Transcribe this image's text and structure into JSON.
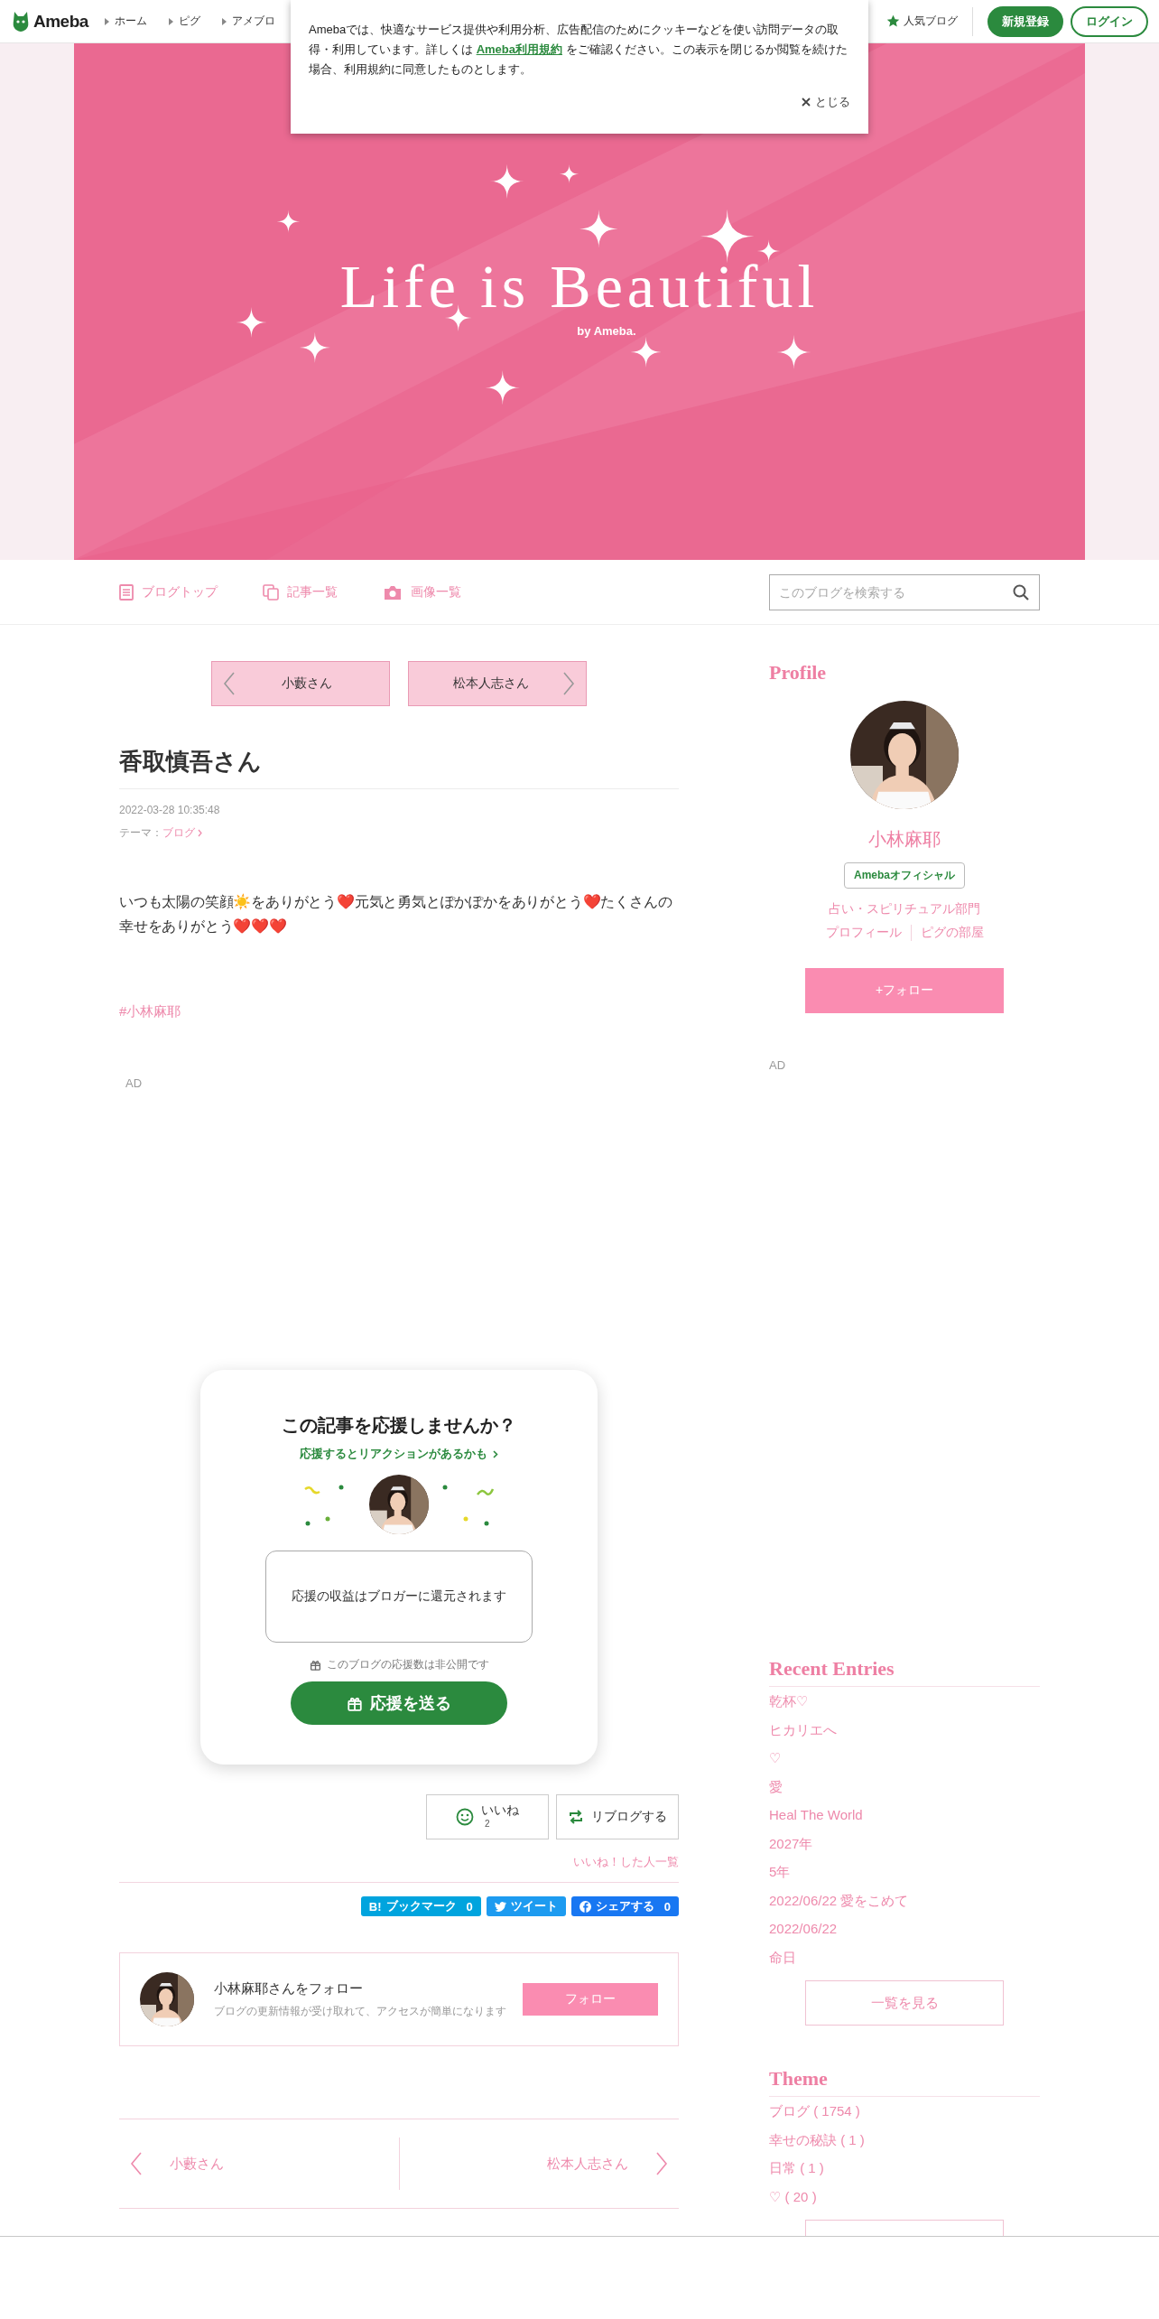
{
  "top_bar": {
    "logo": "Ameba",
    "nav": [
      "ホーム",
      "ピグ",
      "アメブロ"
    ],
    "popular": "人気ブログ",
    "signup": "新規登録",
    "login": "ログイン"
  },
  "cookie_notice": {
    "text": "Amebaでは、快適なサービス提供や利用分析、広告配信のためにクッキーなどを使い訪問データの取得・利用しています。詳しくは",
    "link": "Ameba利用規約",
    "text_after": "をご確認ください。この表示を閉じるか閲覧を続けた場合、利用規約に同意したものとします。",
    "close": "とじる"
  },
  "header": {
    "title": "Life is Beautiful",
    "byline": "by Ameba."
  },
  "blog_nav": {
    "items": [
      {
        "label": "ブログトップ",
        "kind": "list"
      },
      {
        "label": "記事一覧",
        "kind": "pages"
      },
      {
        "label": "画像一覧",
        "kind": "camera"
      }
    ],
    "search": {
      "placeholder": "このブログを検索する"
    }
  },
  "article": {
    "prev": "小藪さん",
    "next": "松本人志さん",
    "title": "香取慎吾さん",
    "date": "2022-03-28 10:35:48",
    "theme_label": "テーマ：",
    "theme": "ブログ",
    "body": "いつも太陽の笑顔☀️をありがとう❤️元気と勇気とぽかぽかをありがとう❤️たくさんの幸せをありがとう❤️❤️❤️",
    "hashtag": "#小林麻耶",
    "ad": "AD"
  },
  "support": {
    "title": "この記事を応援しませんか？",
    "link": "応援するとリアクションがあるかも",
    "message": "応援の収益はブロガーに還元されます",
    "note": "このブログの応援数は非公開です",
    "button": "応援を送る"
  },
  "reactions": {
    "like": "いいね",
    "like_count": "2",
    "reblog": "リブログする",
    "likers_link": "いいね！した人一覧"
  },
  "share": [
    {
      "kind": "hatena",
      "mark": "B!",
      "label": "ブックマーク",
      "count": "0"
    },
    {
      "kind": "twitter",
      "label": "ツイート"
    },
    {
      "kind": "facebook",
      "label": "シェアする",
      "count": "0"
    }
  ],
  "follow_card": {
    "title": "小林麻耶さんをフォロー",
    "subtitle": "ブログの更新情報が受け取れて、アクセスが簡単になります",
    "button": "フォロー"
  },
  "pager": {
    "prev": "小藪さん",
    "next": "松本人志さん"
  },
  "sidebar": {
    "profile": {
      "heading": "Profile",
      "name": "小林麻耶",
      "badge": "Amebaオフィシャル",
      "category": "占い・スピリチュアル部門",
      "links": [
        "プロフィール",
        "ピグの部屋"
      ],
      "follow": "+フォロー"
    },
    "ad": "AD",
    "recent": {
      "heading": "Recent Entries",
      "items": [
        "乾杯♡",
        "ヒカリエへ",
        "♡",
        "愛",
        "Heal The World",
        "2027年",
        "5年",
        "2022/06/22 愛をこめて",
        "2022/06/22",
        "命日"
      ],
      "more": "一覧を見る"
    },
    "theme": {
      "heading": "Theme",
      "items": [
        "ブログ ( 1754 )",
        "幸せの秘訣 ( 1 )",
        "日常 ( 1 )",
        "♡ ( 20 )"
      ]
    }
  }
}
